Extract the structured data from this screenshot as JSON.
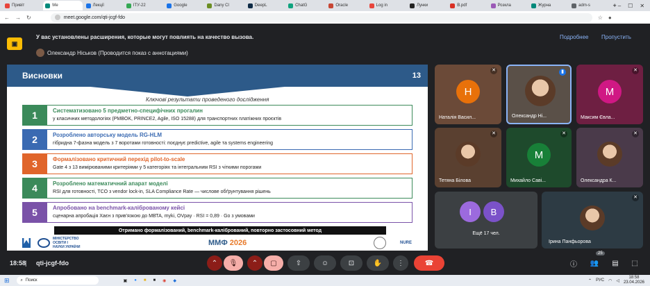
{
  "browser": {
    "tabs": [
      {
        "label": "Привіт",
        "color": "#e8453c"
      },
      {
        "label": "Ме",
        "color": "#00897b"
      },
      {
        "label": "Лекції",
        "color": "#1a73e8"
      },
      {
        "label": "ІТУ-22",
        "color": "#34a853"
      },
      {
        "label": "Google",
        "color": "#1a73e8"
      },
      {
        "label": "Dany Cl",
        "color": "#6b8e23"
      },
      {
        "label": "DeepL",
        "color": "#0f2b46"
      },
      {
        "label": "ChatG",
        "color": "#10a37f"
      },
      {
        "label": "Oracle",
        "color": "#c74634"
      },
      {
        "label": "Log in",
        "color": "#e8453c"
      },
      {
        "label": "Лунки",
        "color": "#222"
      },
      {
        "label": "B.pdf",
        "color": "#d93025"
      },
      {
        "label": "Розкла",
        "color": "#9b59b6"
      },
      {
        "label": "Журна",
        "color": "#00897b"
      },
      {
        "label": "adm-s",
        "color": "#5f6368"
      }
    ],
    "url": "meet.google.com/qti-jcgf-fdo"
  },
  "banner": {
    "text": "У вас установлены расширения, которые могут повлиять на качество вызова.",
    "more": "Подробнее",
    "skip": "Пропустить"
  },
  "presenter": "Олександр Ніськов (Проводится показ с аннотациями)",
  "slide": {
    "title": "Висновки",
    "page": "13",
    "subtitle": "Ключові результати проведеного дослідження",
    "rows": [
      {
        "n": "1",
        "title": "Систематизовано 5 предметно-специфічних прогалин",
        "desc": "у класичних методологіях (PMBOK, PRINCE2, Agile, ISO 15288) для транспортних платіжних проєктів",
        "color": "#3b8a5a"
      },
      {
        "n": "2",
        "title": "Розроблено авторську модель RG-HLM",
        "desc": "гібридна 7-фазна модель з 7 воротами готовності: поєднує predictive, agile та systems engineering",
        "color": "#3a6ab2"
      },
      {
        "n": "3",
        "title": "Формалізовано критичний перехід pilot-to-scale",
        "desc": "Gate 4 з 13 вимірюваними критеріями у 5 категоріях та інтегральним RSI з чіткими порогами",
        "color": "#e0652b"
      },
      {
        "n": "4",
        "title": "Розроблено математичний апарат моделі",
        "desc": "RSI для готовності, TCO з vendor lock-in, SLA Compliance Rate — числове обґрунтування рішень",
        "color": "#3b8a5a"
      },
      {
        "n": "5",
        "title": "Апробовано на benchmark-каліброваному кейсі",
        "desc": "сценарна апробація Хаєн з прив'язкою до МВТА, myki, OVpay  ·  RSI = 0,89  ·  Go з умовами",
        "color": "#7a52a8"
      }
    ],
    "caption": "Отримано формалізований, benchmark-калібрований, повторно застосовний метод",
    "ministry": "МІНІСТЕРСТВО ОСВІТИ І НАУКИ УКРАЇНИ",
    "mmf": "ММФ",
    "year": "2026",
    "nure": "NURE"
  },
  "participants": [
    {
      "name": "Наталія Васил...",
      "initial": "Н",
      "bg": "#6b4a38",
      "circle": "#e8710a"
    },
    {
      "name": "Олександр Ні...",
      "initial": "",
      "bg": "#5a5048",
      "circle": ""
    },
    {
      "name": "Максим Євла...",
      "initial": "M",
      "bg": "#6e1f42",
      "circle": "#d01884"
    },
    {
      "name": "Тетяна Білова",
      "initial": "",
      "bg": "#5a4030",
      "circle": ""
    },
    {
      "name": "Михайло Саві...",
      "initial": "M",
      "bg": "#1e4a2c",
      "circle": "#188038"
    },
    {
      "name": "Олександра К...",
      "initial": "",
      "bg": "#4a3a4a",
      "circle": ""
    },
    {
      "name": "Ещё 17 чел.",
      "initial": "",
      "bg": "#3c4043",
      "circle": ""
    },
    {
      "name": "Ірина Панфьорова",
      "initial": "",
      "bg": "#2d3b44",
      "circle": ""
    }
  ],
  "more_avatars": [
    "I",
    "B"
  ],
  "meeting": {
    "time": "18:58",
    "code": "qti-jcgf-fdo",
    "people_count": "25"
  },
  "taskbar": {
    "search": "Поиск",
    "lang": "РУС",
    "clock": "18:58",
    "date": "23.04.2026"
  }
}
